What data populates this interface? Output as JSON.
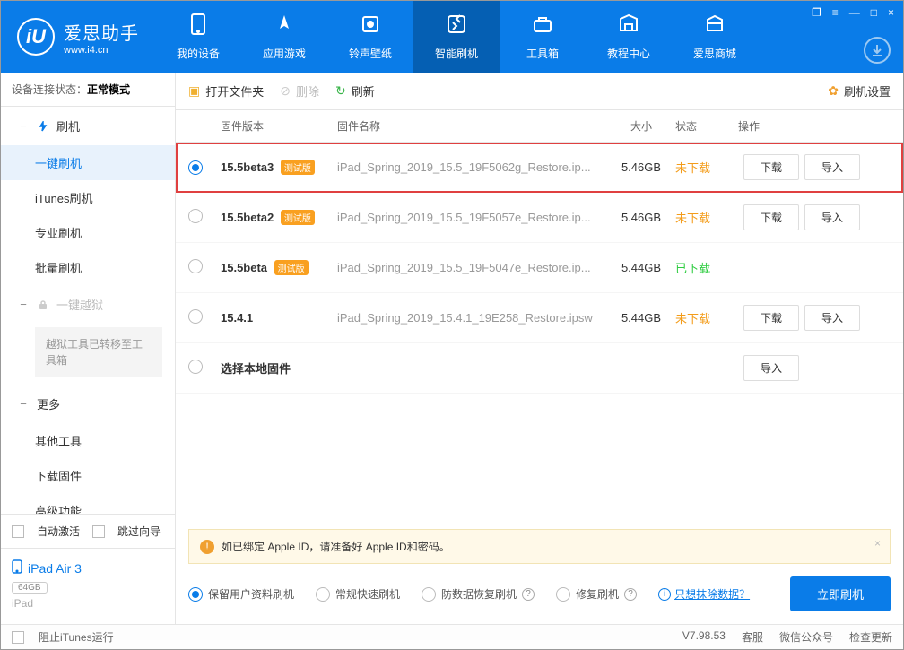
{
  "window": {
    "logo_name": "爱思助手",
    "logo_url": "www.i4.cn",
    "nav": [
      {
        "label": "我的设备"
      },
      {
        "label": "应用游戏"
      },
      {
        "label": "铃声壁纸"
      },
      {
        "label": "智能刷机"
      },
      {
        "label": "工具箱"
      },
      {
        "label": "教程中心"
      },
      {
        "label": "爱思商城"
      }
    ]
  },
  "sidebar": {
    "status_prefix": "设备连接状态：",
    "status_value": "正常模式",
    "group_flash": "刷机",
    "items_flash": [
      "一键刷机",
      "iTunes刷机",
      "专业刷机",
      "批量刷机"
    ],
    "group_jb": "一键越狱",
    "jb_note": "越狱工具已转移至工具箱",
    "group_more": "更多",
    "items_more": [
      "其他工具",
      "下载固件",
      "高级功能"
    ],
    "auto_activate": "自动激活",
    "skip_guide": "跳过向导",
    "device_name": "iPad Air 3",
    "device_cap": "64GB",
    "device_type": "iPad"
  },
  "toolbar": {
    "open": "打开文件夹",
    "delete": "删除",
    "refresh": "刷新",
    "settings": "刷机设置"
  },
  "table": {
    "h_version": "固件版本",
    "h_name": "固件名称",
    "h_size": "大小",
    "h_status": "状态",
    "h_action": "操作",
    "badge_beta": "测试版",
    "btn_download": "下载",
    "btn_import": "导入",
    "rows": [
      {
        "selected": true,
        "version": "15.5beta3",
        "beta": true,
        "name": "iPad_Spring_2019_15.5_19F5062g_Restore.ip...",
        "size": "5.46GB",
        "status": "未下载",
        "status_key": "not",
        "download": true,
        "import": true,
        "highlight": true
      },
      {
        "selected": false,
        "version": "15.5beta2",
        "beta": true,
        "name": "iPad_Spring_2019_15.5_19F5057e_Restore.ip...",
        "size": "5.46GB",
        "status": "未下载",
        "status_key": "not",
        "download": true,
        "import": true
      },
      {
        "selected": false,
        "version": "15.5beta",
        "beta": true,
        "name": "iPad_Spring_2019_15.5_19F5047e_Restore.ip...",
        "size": "5.44GB",
        "status": "已下载",
        "status_key": "done",
        "download": false,
        "import": false
      },
      {
        "selected": false,
        "version": "15.4.1",
        "beta": false,
        "name": "iPad_Spring_2019_15.4.1_19E258_Restore.ipsw",
        "size": "5.44GB",
        "status": "未下载",
        "status_key": "not",
        "download": true,
        "import": true
      },
      {
        "selected": false,
        "version": "选择本地固件",
        "beta": false,
        "name": "",
        "size": "",
        "status": "",
        "status_key": "",
        "download": false,
        "import": true
      }
    ]
  },
  "notice": "如已绑定 Apple ID，请准备好 Apple ID和密码。",
  "modes": {
    "opt1": "保留用户资料刷机",
    "opt2": "常规快速刷机",
    "opt3": "防数据恢复刷机",
    "opt4": "修复刷机",
    "erase_link": "只想抹除数据？",
    "start": "立即刷机"
  },
  "footer": {
    "block_itunes": "阻止iTunes运行",
    "version": "V7.98.53",
    "support": "客服",
    "wechat": "微信公众号",
    "update": "检查更新"
  }
}
